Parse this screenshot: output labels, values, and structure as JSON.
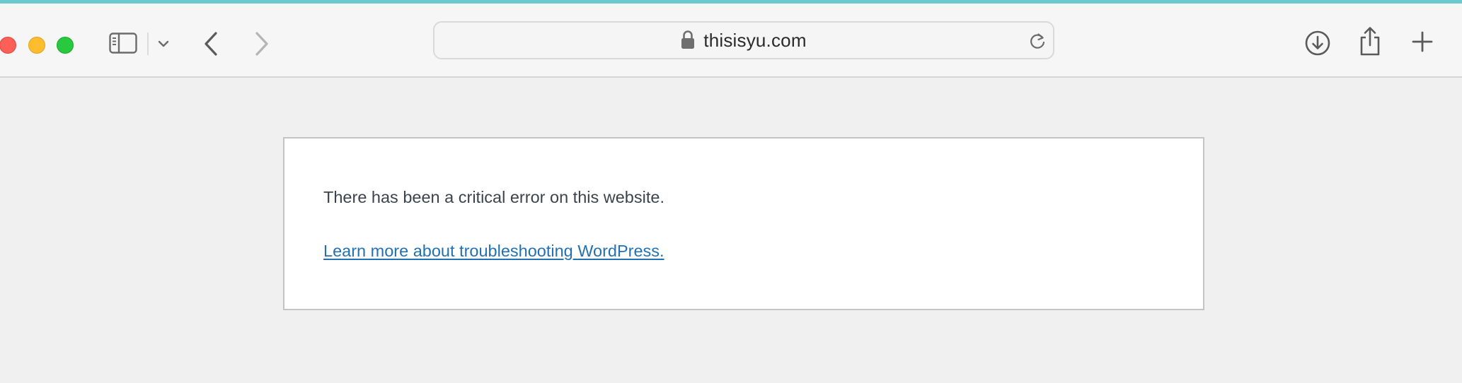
{
  "browser": {
    "url": "thisisyu.com",
    "accent_color": "#6ec9cf",
    "buttons": {
      "close": "close-window",
      "minimize": "minimize-window",
      "maximize": "maximize-window",
      "sidebar": "sidebar-icon",
      "sidebar_menu": "chevron-down-icon",
      "back": "chevron-left-icon",
      "forward": "chevron-right-icon",
      "reload": "reload-icon",
      "downloads": "download-icon",
      "share": "share-icon",
      "new_tab": "plus-icon"
    },
    "lock_icon": "lock-icon"
  },
  "page": {
    "error_message": "There has been a critical error on this website.",
    "help_link": "Learn more about troubleshooting WordPress.",
    "link_color": "#2271b1",
    "text_color": "#3c434a",
    "background_color": "#f0f0f1"
  }
}
